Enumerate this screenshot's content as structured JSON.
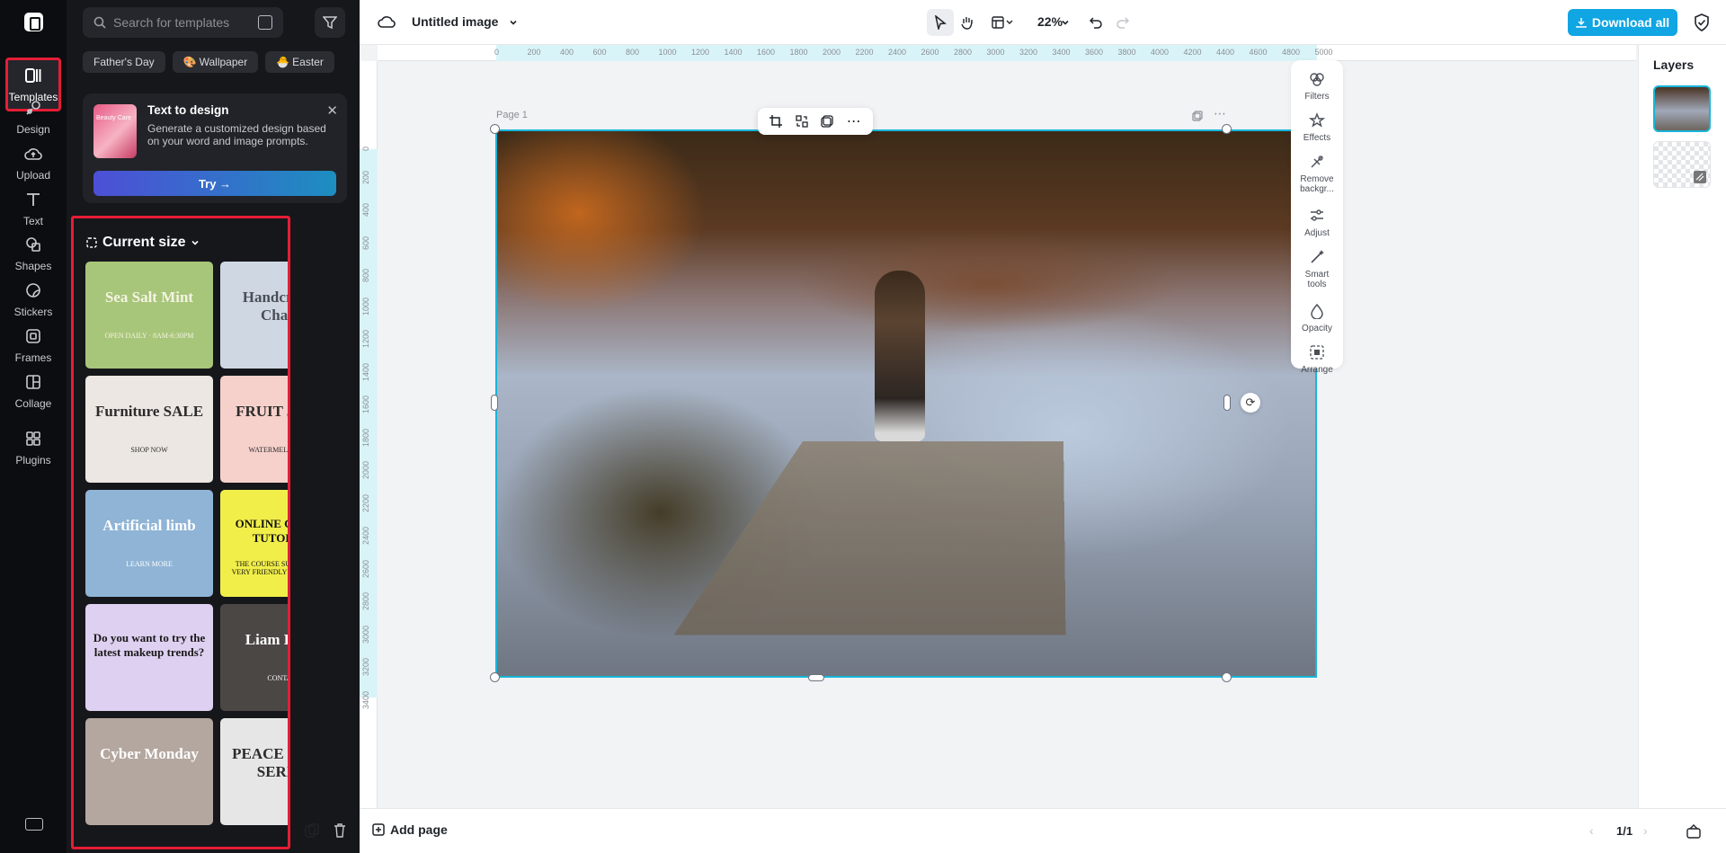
{
  "rail": {
    "items": [
      {
        "label": "Templates",
        "icon": "templates-icon"
      },
      {
        "label": "Design",
        "icon": "design-icon"
      },
      {
        "label": "Upload",
        "icon": "upload-icon"
      },
      {
        "label": "Text",
        "icon": "text-icon"
      },
      {
        "label": "Shapes",
        "icon": "shapes-icon"
      },
      {
        "label": "Stickers",
        "icon": "stickers-icon"
      },
      {
        "label": "Frames",
        "icon": "frames-icon"
      },
      {
        "label": "Collage",
        "icon": "collage-icon"
      },
      {
        "label": "Plugins",
        "icon": "plugins-icon"
      }
    ]
  },
  "panel": {
    "search_placeholder": "Search for templates",
    "chips": [
      "Father's Day",
      "Wallpaper",
      "Easter"
    ],
    "promo": {
      "title": "Text to design",
      "description": "Generate a customized design based on your word and image prompts.",
      "button": "Try →",
      "thumb_label": "Beauty Care"
    },
    "section_title": "Current size",
    "templates": [
      {
        "title": "Sea Salt Mint",
        "sub": "OPEN DAILY · 8AM-6:30PM",
        "bg": "#a8c67a",
        "fg": "#f4f3e2"
      },
      {
        "title": "Handcrafted Charm",
        "sub": "",
        "bg": "#cfd8e2",
        "fg": "#4a4e57"
      },
      {
        "title": "Furniture SALE",
        "sub": "SHOP NOW",
        "bg": "#ece7e2",
        "fg": "#2b2b2b"
      },
      {
        "title": "FRUIT JUICE",
        "sub": "WATERMELON JUICE",
        "bg": "#f6d1cb",
        "fg": "#2b2b2b"
      },
      {
        "title": "Artificial limb",
        "sub": "LEARN MORE",
        "bg": "#8fb4d6",
        "fg": "#ffffff"
      },
      {
        "title": "ONLINE COURSE TUTORING",
        "sub": "THE COURSE SUPERVISOR IS VERY FRIENDLY TO STUDENTS",
        "bg": "#f1ee4a",
        "fg": "#111111"
      },
      {
        "title": "Do you want to try the latest makeup trends?",
        "sub": "",
        "bg": "#ded0f0",
        "fg": "#1a1a1a"
      },
      {
        "title": "Liam David",
        "sub": "CONTACT",
        "bg": "#4b4744",
        "fg": "#ffffff"
      },
      {
        "title": "Cyber Monday",
        "sub": "",
        "bg": "#b4a7a0",
        "fg": "#ffffff"
      },
      {
        "title": "PEACE HOME SERIES",
        "sub": "",
        "bg": "#e6e6e6",
        "fg": "#2b2b2b"
      }
    ]
  },
  "topbar": {
    "doc_title": "Untitled image",
    "zoom": "22%",
    "download": "Download all"
  },
  "canvas": {
    "page_label": "Page 1",
    "ruler_h": [
      "0",
      "200",
      "400",
      "600",
      "800",
      "1000",
      "1200",
      "1400",
      "1600",
      "1800",
      "2000",
      "2200",
      "2400",
      "2600",
      "2800",
      "3000",
      "3200",
      "3400",
      "3600",
      "3800",
      "4000",
      "4200",
      "4400",
      "4600",
      "4800",
      "5000"
    ],
    "ruler_v": [
      "0",
      "200",
      "400",
      "600",
      "800",
      "1000",
      "1200",
      "1400",
      "1600",
      "1800",
      "2000",
      "2200",
      "2400",
      "2600",
      "2800",
      "3000",
      "3200",
      "3400"
    ]
  },
  "right_tools": [
    {
      "label": "Filters",
      "icon": "filters-icon"
    },
    {
      "label": "Effects",
      "icon": "effects-icon"
    },
    {
      "label": "Remove backgr...",
      "icon": "remove-background-icon"
    },
    {
      "label": "Adjust",
      "icon": "adjust-icon"
    },
    {
      "label": "Smart tools",
      "icon": "smart-tools-icon"
    },
    {
      "label": "Opacity",
      "icon": "opacity-icon"
    },
    {
      "label": "Arrange",
      "icon": "arrange-icon"
    }
  ],
  "layers": {
    "title": "Layers"
  },
  "bottombar": {
    "add_page": "Add page",
    "pager": "1/1"
  }
}
